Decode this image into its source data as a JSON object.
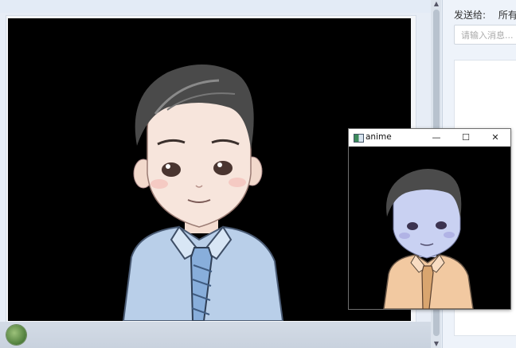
{
  "chat": {
    "send_to_label": "发送给:",
    "send_to_value": "所有人",
    "input_placeholder": "请输入消息..."
  },
  "anime_window": {
    "title": "anime",
    "minimize_glyph": "—",
    "maximize_glyph": "☐",
    "close_glyph": "✕"
  },
  "scrollbar": {
    "up_glyph": "▲",
    "down_glyph": "▼"
  },
  "colors": {
    "video_background": "#000000",
    "shirt_main": "#b9cfe9",
    "shirt_preview": "#f2c9a1",
    "skin_preview": "#c9d1f2"
  }
}
